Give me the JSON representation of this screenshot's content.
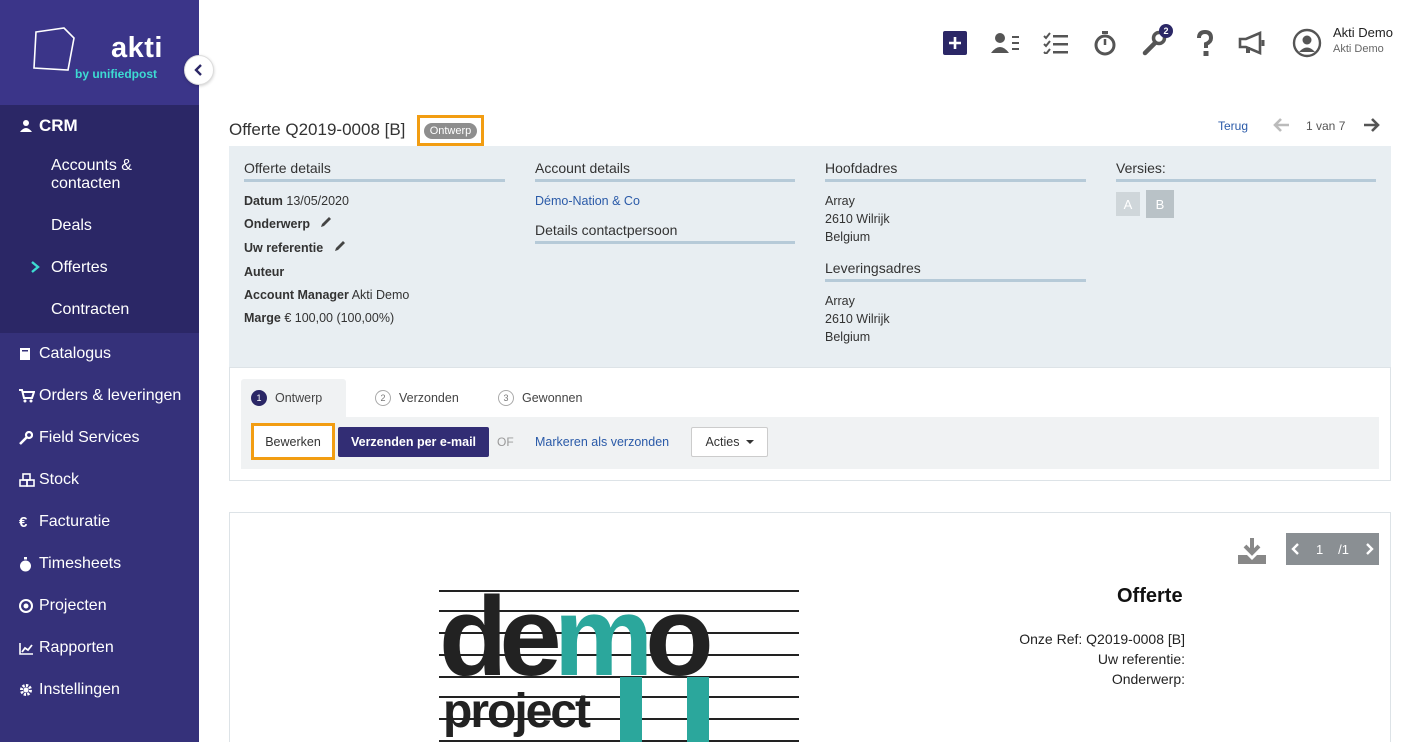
{
  "brand": {
    "name": "akti",
    "tagline": "by unifiedpost"
  },
  "sidebar": {
    "crm_label": "CRM",
    "crm_items": [
      {
        "label": "Accounts &\ncontacten"
      },
      {
        "label": "Deals"
      },
      {
        "label": "Offertes",
        "active": true
      },
      {
        "label": "Contracten"
      }
    ],
    "items": [
      {
        "label": "Catalogus",
        "icon": "book-icon"
      },
      {
        "label": "Orders & leveringen",
        "icon": "cart-icon"
      },
      {
        "label": "Field Services",
        "icon": "wrench-icon"
      },
      {
        "label": "Stock",
        "icon": "cubes-icon"
      },
      {
        "label": "Facturatie",
        "icon": "euro-icon"
      },
      {
        "label": "Timesheets",
        "icon": "stopwatch-icon"
      },
      {
        "label": "Projecten",
        "icon": "target-icon"
      },
      {
        "label": "Rapporten",
        "icon": "chart-icon"
      },
      {
        "label": "Instellingen",
        "icon": "gear-icon"
      }
    ]
  },
  "topbar": {
    "badge_count": "2",
    "user_name": "Akti Demo",
    "user_company": "Akti Demo"
  },
  "header": {
    "title": "Offerte Q2019-0008 [B]",
    "status": "Ontwerp",
    "back_label": "Terug",
    "pager": "1 van 7"
  },
  "details": {
    "offer": {
      "heading": "Offerte details",
      "datum_label": "Datum",
      "datum_value": "13/05/2020",
      "onderwerp_label": "Onderwerp",
      "referentie_label": "Uw referentie",
      "auteur_label": "Auteur",
      "manager_label": "Account Manager",
      "manager_value": "Akti Demo",
      "marge_label": "Marge",
      "marge_value": "€ 100,00 (100,00%)"
    },
    "account": {
      "heading": "Account details",
      "name": "Démo-Nation & Co",
      "contact_heading": "Details contactpersoon"
    },
    "address": {
      "heading": "Hoofdadres",
      "line1": "Array",
      "line2": "2610 Wilrijk",
      "line3": "Belgium",
      "delivery_heading": "Leveringsadres",
      "d_line1": "Array",
      "d_line2": "2610 Wilrijk",
      "d_line3": "Belgium"
    },
    "versions": {
      "heading": "Versies:",
      "a": "A",
      "b": "B"
    }
  },
  "workflow": {
    "steps": [
      {
        "num": "1",
        "label": "Ontwerp"
      },
      {
        "num": "2",
        "label": "Verzonden"
      },
      {
        "num": "3",
        "label": "Gewonnen"
      }
    ],
    "edit_label": "Bewerken",
    "send_label": "Verzenden per e-mail",
    "or_label": "OF",
    "mark_label": "Markeren als verzonden",
    "actions_label": "Acties"
  },
  "preview": {
    "page_current": "1",
    "page_total": "/1",
    "doc_title": "Offerte",
    "ref_line": "Onze Ref: Q2019-0008 [B]",
    "referentie_line": "Uw referentie:",
    "onderwerp_line": "Onderwerp:",
    "logo_text_top": "demo",
    "logo_text_bottom": "project"
  },
  "colors": {
    "sidebar": "#35317a",
    "accent": "#f29d12",
    "teal": "#3ddbd2",
    "primary_button": "#322d74"
  }
}
